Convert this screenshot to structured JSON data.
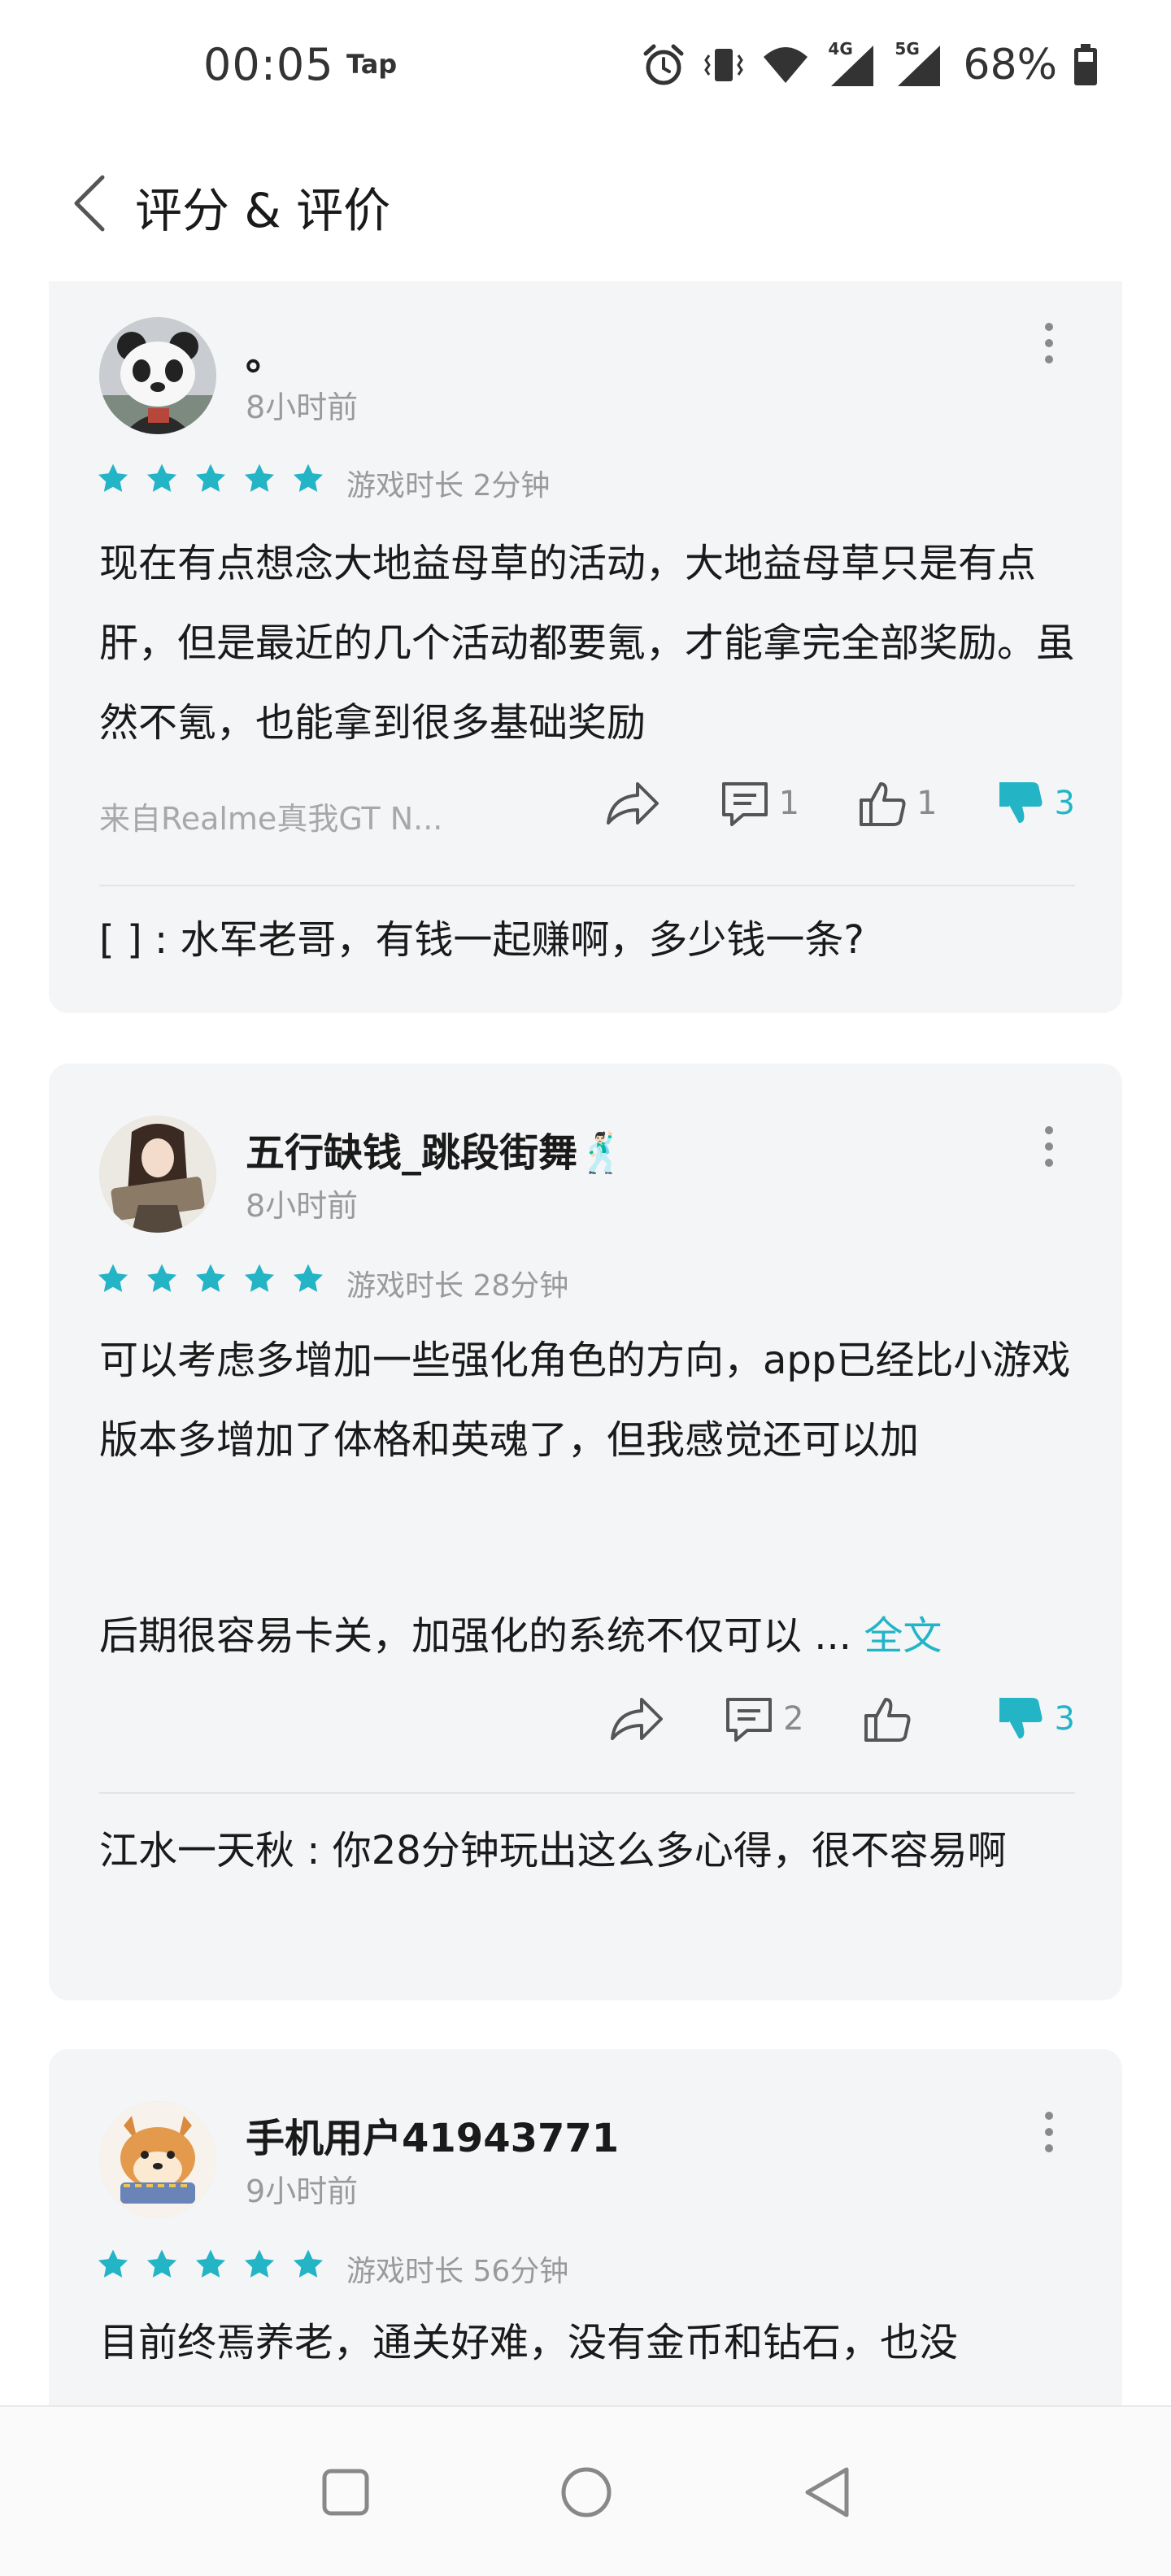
{
  "status_bar": {
    "time": "00:05",
    "tap_label": "Tap",
    "network_4g": "4G",
    "network_5g": "5G",
    "battery": "68%"
  },
  "header": {
    "title": "评分 & 评价"
  },
  "reviews": [
    {
      "user": "。",
      "time": "8小时前",
      "rating": 5,
      "play_time": "游戏时长 2分钟",
      "text": "现在有点想念大地益母草的活动，大地益母草只是有点肝，但是最近的几个活动都要氪，才能拿完全部奖励。虽然不氪，也能拿到很多基础奖励",
      "device": "来自Realme真我GT N...",
      "comments": "1",
      "likes": "1",
      "dislikes": "3",
      "reply": "[      ] : 水军老哥，有钱一起赚啊，多少钱一条?"
    },
    {
      "user": "五行缺钱_跳段街舞🕺🏻",
      "time": "8小时前",
      "rating": 5,
      "play_time": "游戏时长 28分钟",
      "text": "可以考虑多增加一些强化角色的方向，app已经比小游戏版本多增加了体格和英魂了，但我感觉还可以加",
      "text_more": "后期很容易卡关，加强化的系统不仅可以 ...",
      "full_text_label": "全文",
      "comments": "2",
      "likes": "",
      "dislikes": "3",
      "reply": "江水一天秋 : 你28分钟玩出这么多心得，很不容易啊"
    },
    {
      "user": "手机用户41943771",
      "time": "9小时前",
      "rating": 5,
      "play_time": "游戏时长 56分钟",
      "text": "目前终焉养老，通关好难，没有金币和钻石，也没"
    }
  ],
  "colors": {
    "accent": "#23b4c6",
    "card_background": "#f4f5f7",
    "secondary_text": "#9a9a9a"
  }
}
